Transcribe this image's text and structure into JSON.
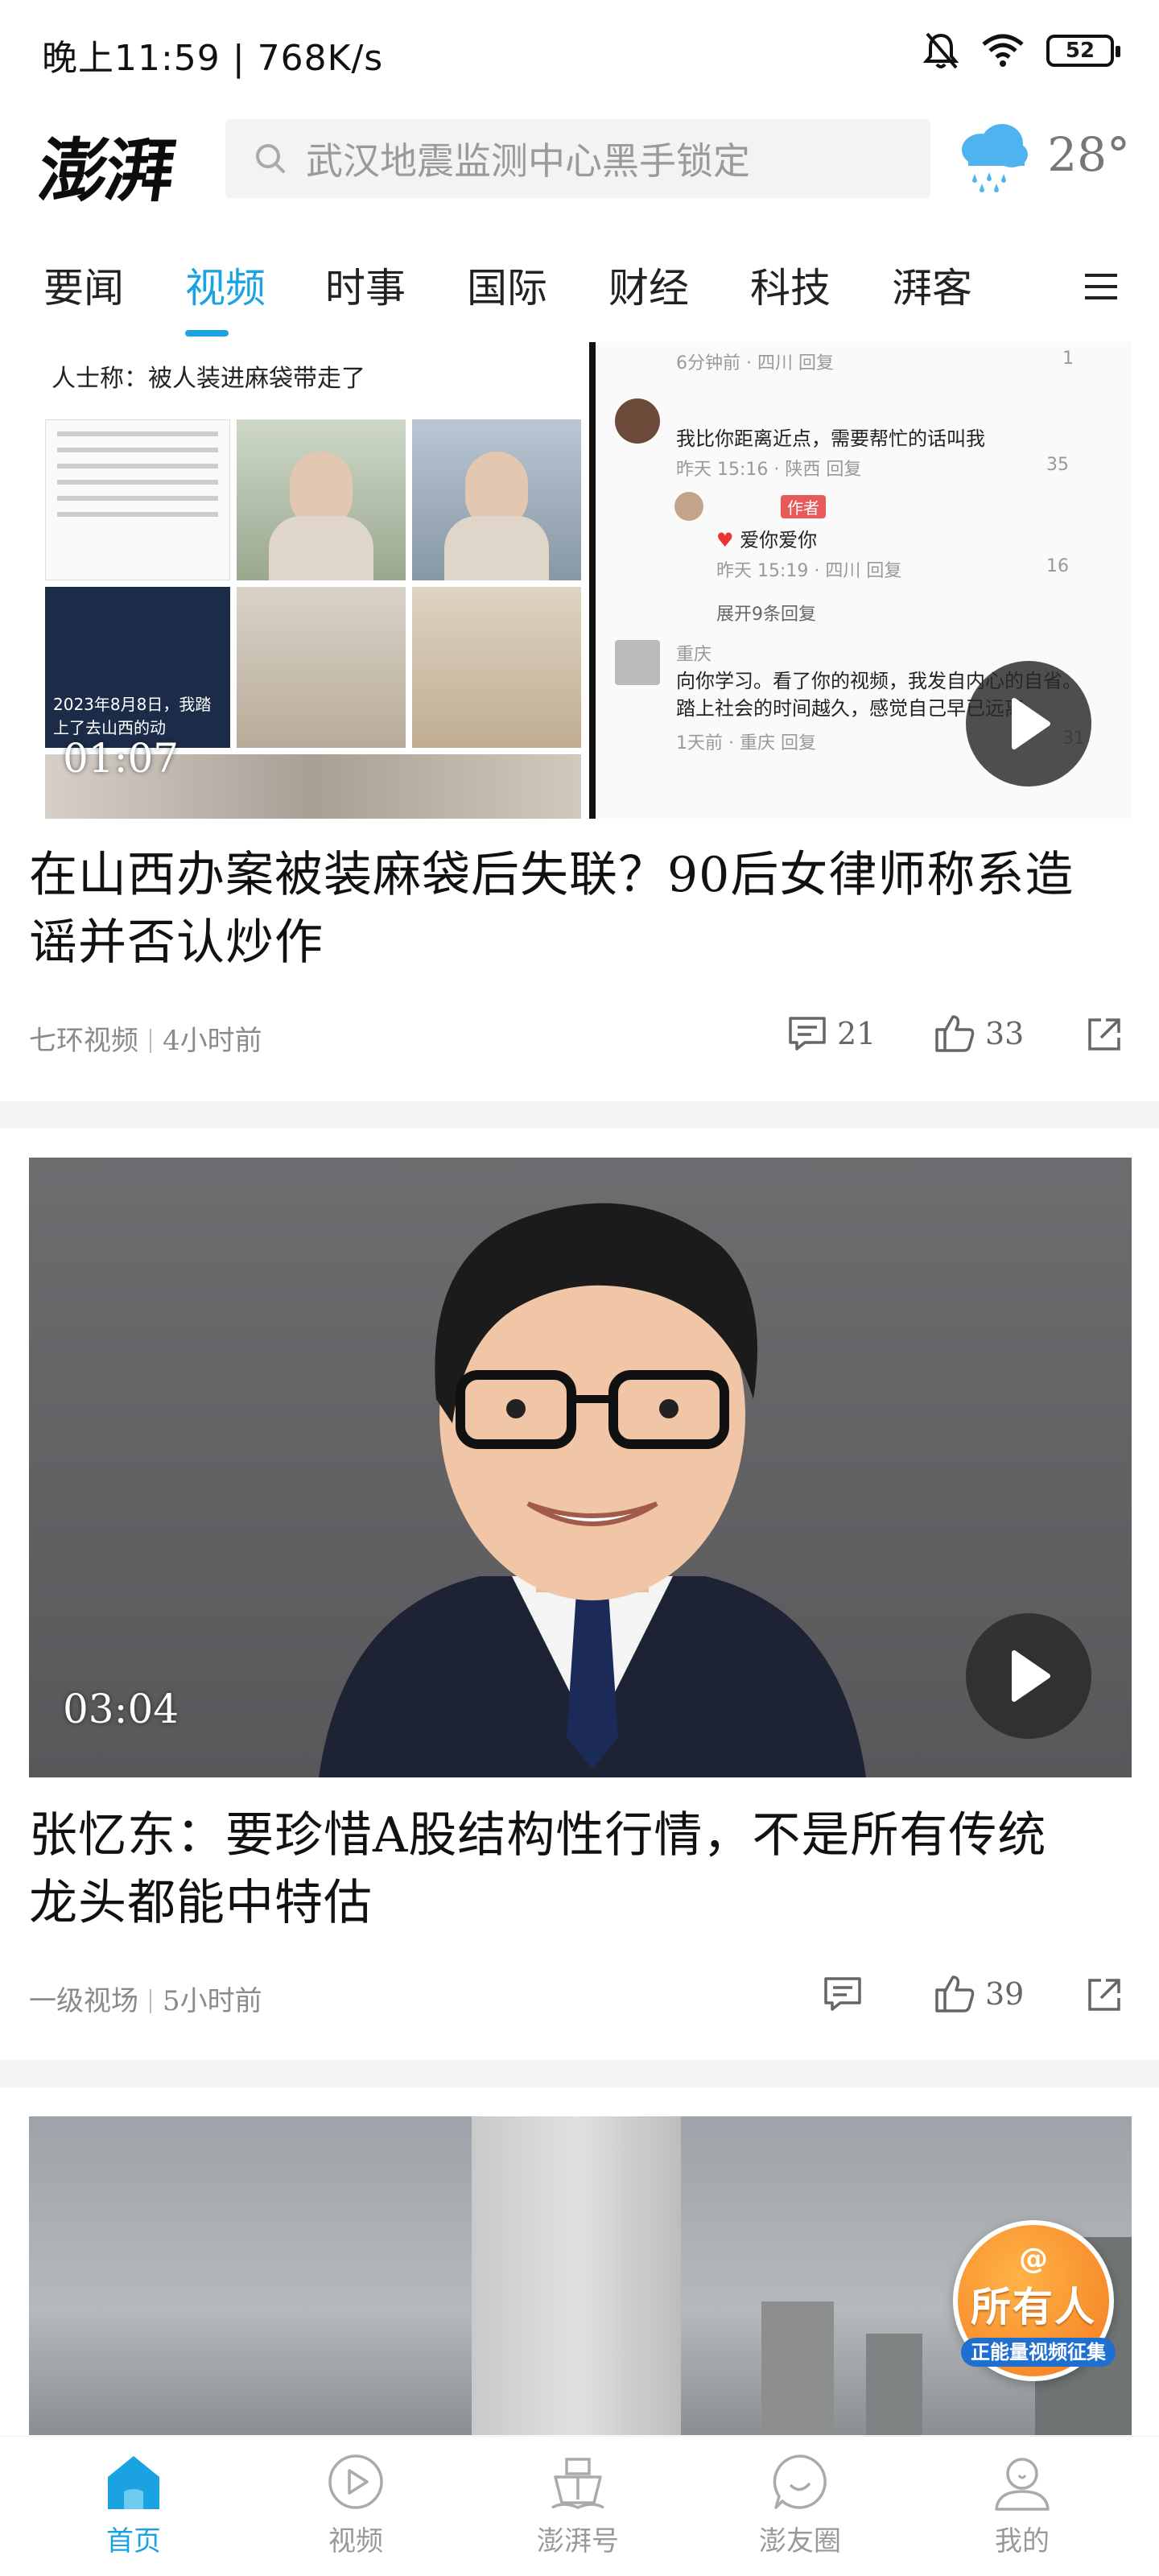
{
  "status_bar": {
    "time": "晚上11:59",
    "speed": "768K/s",
    "battery": "52"
  },
  "header": {
    "logo": "澎湃",
    "search_placeholder": "武汉地震监测中心黑手锁定",
    "weather_temp": "28°",
    "weather_icon": "rain-cloud-icon"
  },
  "tabs": [
    "要闻",
    "视频",
    "时事",
    "国际",
    "财经",
    "科技",
    "湃客"
  ],
  "active_tab": "视频",
  "feed": [
    {
      "duration": "01:07",
      "title_line1": "在山西办案被装麻袋后失联？90后女律师称系造",
      "title_line2": "谣并否认炒作",
      "source": "七环视频",
      "time": "4小时前",
      "comments": "21",
      "likes": "33",
      "thumb_text": {
        "headline": "人士称：被人装进麻袋带走了",
        "left_caption": "2023年8月8日，我踏上了去山西的动",
        "comment1": "我比你距离近点，需要帮忙的话叫我",
        "comment1_meta": "昨天 15:16 · 陕西   回复",
        "comment1_likes": "35",
        "reply_badge": "作者",
        "reply_text": "爱你爱你",
        "reply_meta": "昨天 15:19 · 四川   回复",
        "reply_likes": "16",
        "expand": "展开9条回复",
        "comment2_user": "重庆",
        "comment2_text": "向你学习。看了你的视频，我发自内心的自省。踏上社会的时间越久，感觉自己早已远离",
        "comment2_meta": "1天前 · 重庆   回复",
        "comment2_likes": "31",
        "top_meta": "6分钟前 · 四川   回复",
        "top_likes": "1"
      }
    },
    {
      "duration": "03:04",
      "title_line1": "张忆东：要珍惜A股结构性行情，不是所有传统",
      "title_line2": "龙头都能中特估",
      "source": "一级视场",
      "time": "5小时前",
      "comments": "",
      "likes": "39"
    }
  ],
  "float_badge": {
    "at": "@",
    "big": "所有人",
    "small": "正能量视频征集"
  },
  "bottom_nav": [
    {
      "label": "首页",
      "icon": "home-icon"
    },
    {
      "label": "视频",
      "icon": "play-circle-icon"
    },
    {
      "label": "澎湃号",
      "icon": "ship-icon"
    },
    {
      "label": "澎友圈",
      "icon": "chat-bubble-icon"
    },
    {
      "label": "我的",
      "icon": "user-icon"
    }
  ],
  "colors": {
    "accent": "#1aa3e0",
    "badge_orange": "#f47b20"
  }
}
